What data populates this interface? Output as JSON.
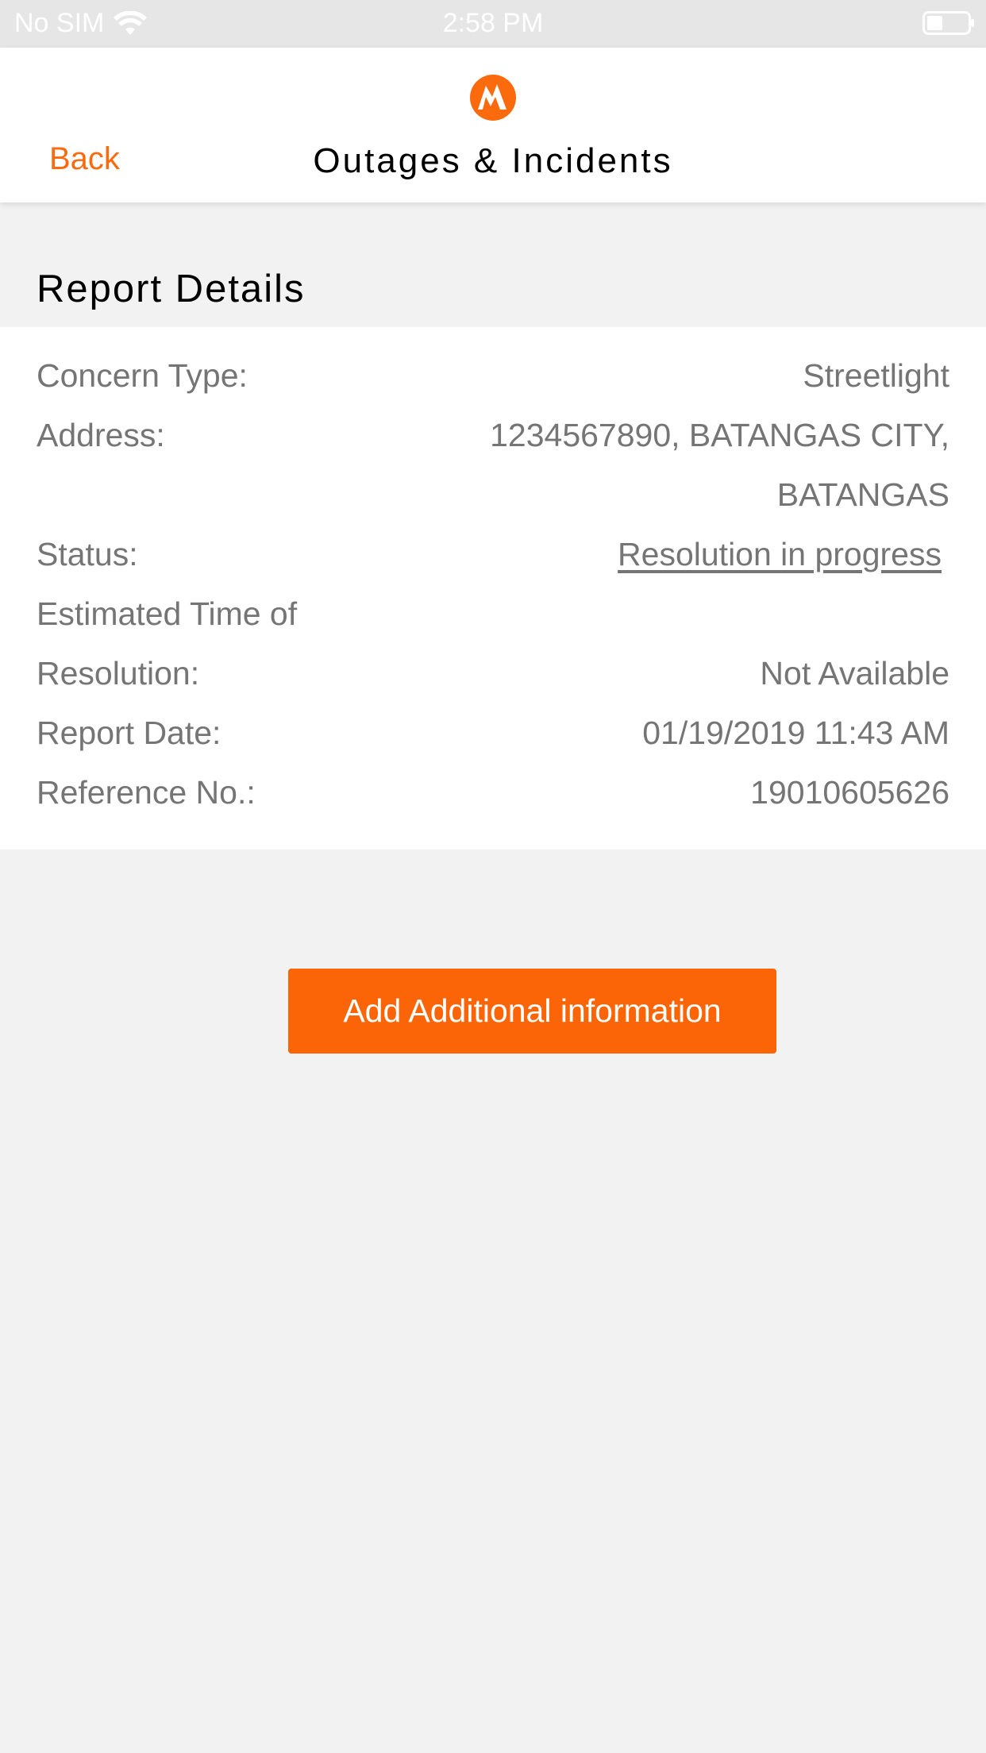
{
  "status_bar": {
    "carrier": "No SIM",
    "time": "2:58 PM"
  },
  "nav": {
    "back_label": "Back",
    "title": "Outages & Incidents",
    "brand_color": "#fb6a0c"
  },
  "report": {
    "heading": "Report Details",
    "concern_type_label": "Concern Type:",
    "concern_type_value": "Streetlight",
    "address_label": "Address:",
    "address_line1": "1234567890, BATANGAS CITY,",
    "address_line2": "BATANGAS",
    "status_label": "Status:",
    "status_value": "Resolution in progress",
    "etr_label_line1": "Estimated Time of",
    "etr_label_line2": "Resolution:",
    "etr_value": "Not Available",
    "report_date_label": "Report Date:",
    "report_date_value": "01/19/2019 11:43 AM",
    "reference_label": "Reference No.:",
    "reference_value": "19010605626"
  },
  "actions": {
    "add_info_label": "Add Additional information",
    "button_color": "#fb6507"
  },
  "icons": {
    "wifi": "wifi-icon",
    "battery": "battery-icon",
    "logo": "meralco-logo-icon"
  }
}
